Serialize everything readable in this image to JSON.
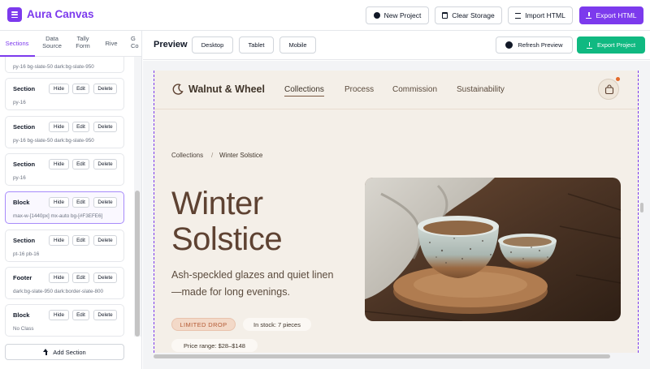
{
  "app": {
    "title": "Aura Canvas",
    "accent_color": "#7c3aed",
    "toolbar": {
      "new_project": "New Project",
      "clear_storage": "Clear Storage",
      "import_html": "Import HTML",
      "export_html": "Export HTML"
    }
  },
  "sidebar": {
    "tabs": [
      {
        "label": "Sections",
        "active": true
      },
      {
        "label": "Data Source"
      },
      {
        "label": "Tally Form"
      },
      {
        "label": "Rive"
      },
      {
        "label": "G Co"
      }
    ],
    "partial_top_class": "py-16 bg-slate-50 dark:bg-slate-950",
    "sections": [
      {
        "title": "Section",
        "classes": "py-16"
      },
      {
        "title": "Section",
        "classes": "py-16 bg-slate-50 dark:bg-slate-950"
      },
      {
        "title": "Section",
        "classes": "py-16"
      },
      {
        "title": "Block",
        "classes": "max-w-[1440px] mx-auto bg-[#F3EFE6]",
        "selected": true
      },
      {
        "title": "Section",
        "classes": "pt-16 pb-16"
      },
      {
        "title": "Footer",
        "classes": "dark:bg-slate-950 dark:border-slate-800"
      },
      {
        "title": "Block",
        "classes": "No Class"
      }
    ],
    "actions": {
      "hide": "Hide",
      "edit": "Edit",
      "delete": "Delete"
    },
    "add_section": "Add Section"
  },
  "preview": {
    "label": "Preview",
    "devices": [
      "Desktop",
      "Tablet",
      "Mobile"
    ],
    "refresh": "Refresh Preview",
    "export_project": "Export Project",
    "export_color": "#10b981"
  },
  "site": {
    "brand": "Walnut & Wheel",
    "nav": [
      "Collections",
      "Process",
      "Commission",
      "Sustainability"
    ],
    "active_nav": "Collections",
    "breadcrumb": [
      "Collections",
      "/",
      "Winter Solstice"
    ],
    "hero_title_line1": "Winter",
    "hero_title_line2": "Solstice",
    "hero_subtitle": "Ash-speckled glazes and quiet linen—made for long evenings.",
    "badge": "LIMITED DROP",
    "stock": "In stock: 7 pieces",
    "price": "Price range: $28–$148",
    "bg_color": "#f4efe8",
    "heading_color": "#5e4232"
  }
}
